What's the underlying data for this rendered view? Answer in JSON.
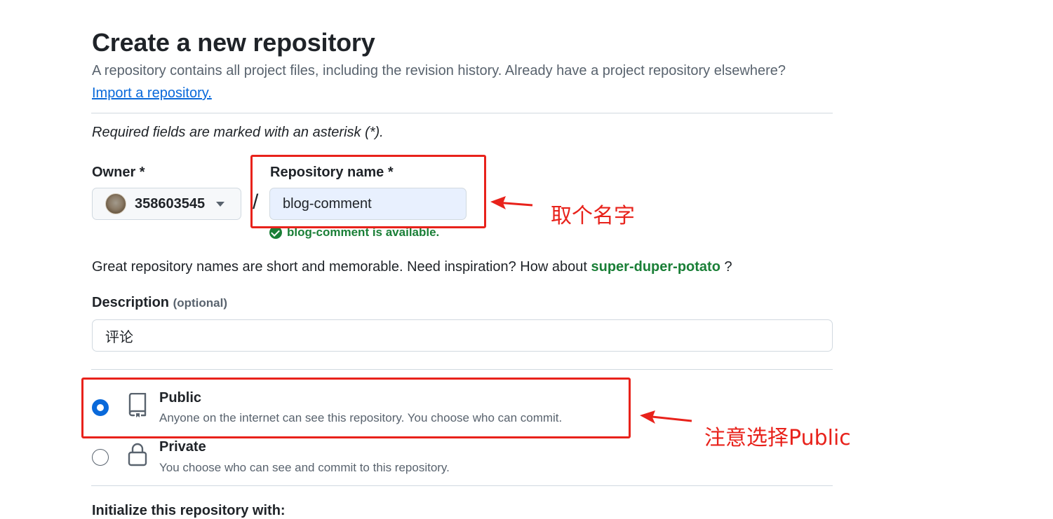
{
  "page": {
    "title": "Create a new repository",
    "subtitle": "A repository contains all project files, including the revision history. Already have a project repository elsewhere?",
    "import_link": "Import a repository.",
    "required_note": "Required fields are marked with an asterisk (*)."
  },
  "owner": {
    "label": "Owner *",
    "value": "358603545"
  },
  "repo_name": {
    "label": "Repository name *",
    "value": "blog-comment",
    "availability": "blog-comment is available."
  },
  "inspiration": {
    "text": "Great repository names are short and memorable. Need inspiration? How about",
    "suggestion": "super-duper-potato",
    "suffix": "?"
  },
  "description": {
    "label": "Description",
    "optional": "(optional)",
    "value": "评论"
  },
  "visibility": {
    "options": [
      {
        "title": "Public",
        "desc": "Anyone on the internet can see this repository. You choose who can commit.",
        "selected": true,
        "icon": "repo-icon"
      },
      {
        "title": "Private",
        "desc": "You choose who can see and commit to this repository.",
        "selected": false,
        "icon": "lock-icon"
      }
    ]
  },
  "next_section": "Initialize this repository with:",
  "annotations": {
    "name_note": "取个名字",
    "public_note": "注意选择Public",
    "color": "#e8221b"
  },
  "colors": {
    "link": "#0969da",
    "success": "#1a7f37",
    "muted": "#59636e",
    "border": "#d1d9e0"
  }
}
